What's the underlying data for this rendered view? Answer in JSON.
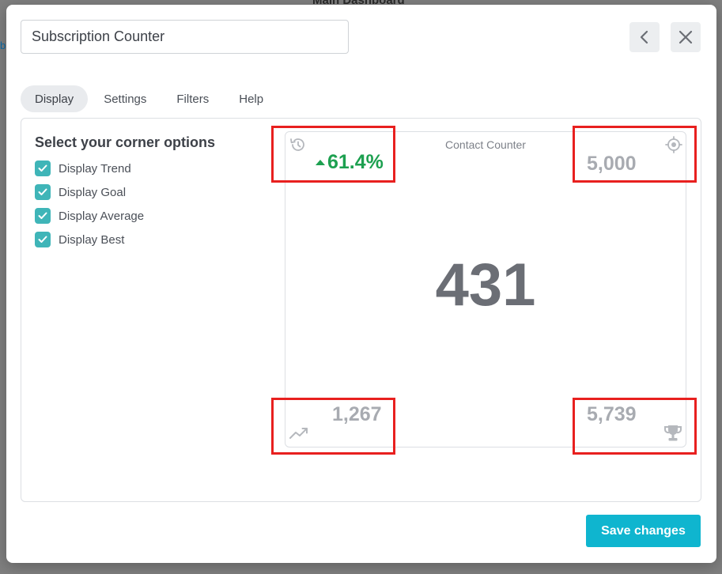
{
  "background": {
    "title": "Main Dashboard",
    "edge_text": "b"
  },
  "header": {
    "title_value": "Subscription Counter",
    "back_icon": "chevron-left-icon",
    "close_icon": "close-icon"
  },
  "tabs": [
    {
      "label": "Display",
      "active": true
    },
    {
      "label": "Settings",
      "active": false
    },
    {
      "label": "Filters",
      "active": false
    },
    {
      "label": "Help",
      "active": false
    }
  ],
  "panel": {
    "heading": "Select your corner options",
    "options": [
      {
        "label": "Display Trend",
        "checked": true
      },
      {
        "label": "Display Goal",
        "checked": true
      },
      {
        "label": "Display Average",
        "checked": true
      },
      {
        "label": "Display Best",
        "checked": true
      }
    ]
  },
  "preview": {
    "title": "Contact Counter",
    "value": "431",
    "trend": {
      "value": "61.4%",
      "direction": "up",
      "color": "#1da050",
      "icon": "history-icon"
    },
    "goal": {
      "value": "5,000",
      "icon": "target-icon"
    },
    "average": {
      "value": "1,267",
      "icon": "trend-line-icon"
    },
    "best": {
      "value": "5,739",
      "icon": "trophy-icon"
    }
  },
  "footer": {
    "save_label": "Save changes"
  },
  "colors": {
    "accent": "#0fb5cf",
    "checkbox": "#3fb5b8",
    "highlight": "#e8201f",
    "trend_up": "#1da050"
  }
}
